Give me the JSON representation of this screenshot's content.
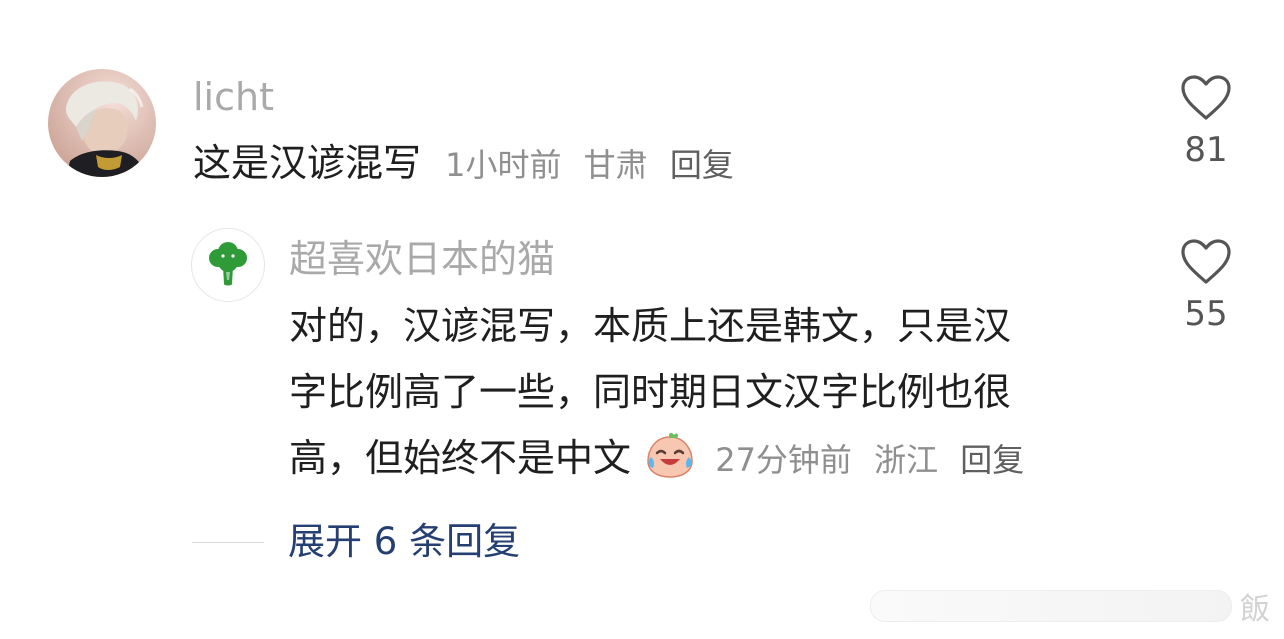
{
  "top_comment": {
    "username": "licht",
    "text": "这是汉谚混写",
    "time": "1小时前",
    "location": "甘肃",
    "reply_label": "回复",
    "likes": "81"
  },
  "reply_comment": {
    "username": "超喜欢日本的猫",
    "lines": [
      "对的，汉谚混写，本质上还是韩文，只是汉",
      "字比例高了一些，同时期日文汉字比例也很",
      "高，但始终不是中文"
    ],
    "time": "27分钟前",
    "location": "浙江",
    "reply_label": "回复",
    "likes": "55"
  },
  "expand_replies": "展开 6 条回复",
  "watermark_char": "飯",
  "icons": {
    "like": "heart-outline-icon",
    "reply_avatar": "broccoli-icon",
    "emoji": "laughing-crying-peach-emoji"
  },
  "colors": {
    "username": "#a9a9a9",
    "text": "#1f1f1f",
    "meta": "#8f8f8f",
    "link": "#253f73"
  }
}
